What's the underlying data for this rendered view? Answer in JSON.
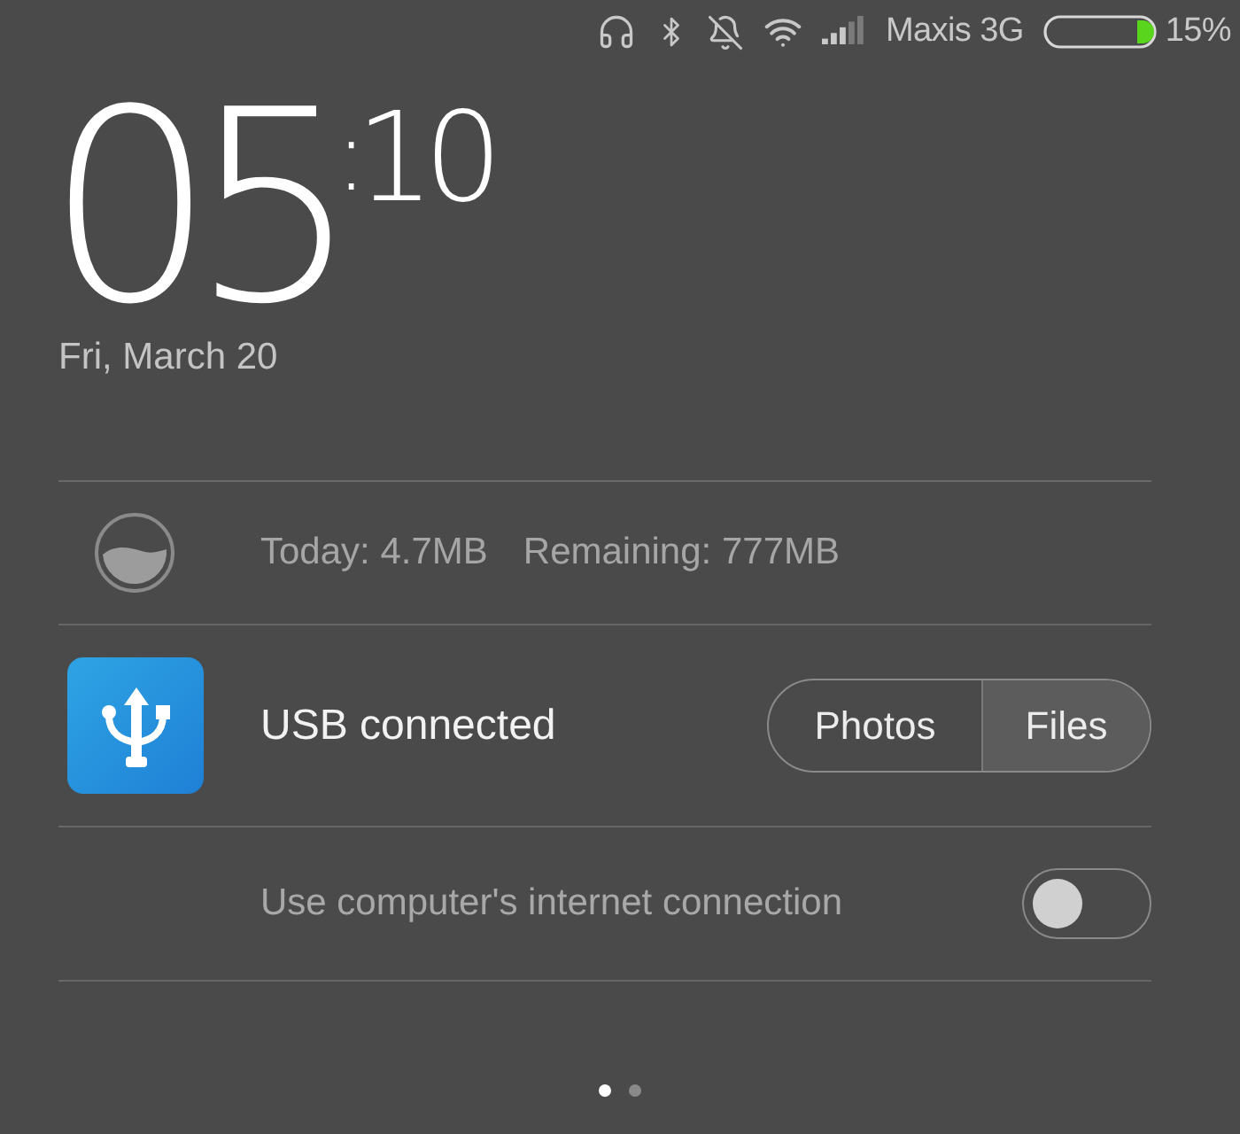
{
  "status_bar": {
    "carrier": "Maxis 3G",
    "battery_percent": "15%"
  },
  "clock": {
    "hours": "05",
    "separator": ":",
    "minutes": "10",
    "date": "Fri, March 20"
  },
  "data_usage": {
    "today": "Today: 4.7MB",
    "remaining": "Remaining: 777MB"
  },
  "usb": {
    "title": "USB connected",
    "modes": [
      {
        "label": "Photos",
        "selected": false
      },
      {
        "label": "Files",
        "selected": true
      }
    ]
  },
  "tethering": {
    "label": "Use computer's internet connection",
    "on": false
  },
  "pages": [
    {
      "selected": true
    },
    {
      "selected": false
    }
  ]
}
